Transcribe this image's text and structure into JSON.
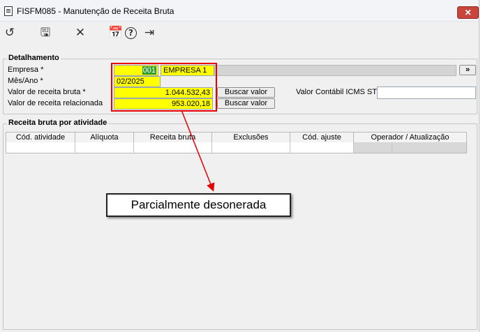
{
  "window": {
    "title": "FISFM085 - Manutenção de Receita Bruta",
    "close_label": "✕"
  },
  "toolbar": {
    "undo_icon": "↺",
    "save_icon": "🖫",
    "cancel_icon": "✕",
    "calendar_icon": "📅",
    "help_icon": "?",
    "exit_icon": "⇥"
  },
  "detalhamento": {
    "legend": "Detalhamento",
    "empresa_label": "Empresa *",
    "empresa_code": "001",
    "empresa_name": "EMPRESA 1",
    "lookup_label": "»",
    "mes_ano_label": "Mês/Ano *",
    "mes_ano_value": "02/2025",
    "receita_bruta_label": "Valor de receita bruta *",
    "receita_bruta_value": "1.044.532,43",
    "receita_relacionada_label": "Valor de receita relacionada",
    "receita_relacionada_value": "953.020,18",
    "buscar_label": "Buscar valor",
    "icms_st_label": "Valor Contábil ICMS ST",
    "icms_st_value": ""
  },
  "atividade": {
    "legend": "Receita bruta por atividade",
    "columns": [
      "Cód. atividade",
      "Alíquota",
      "Receita bruta",
      "Exclusões",
      "Cód. ajuste",
      "Operador / Atualização"
    ]
  },
  "annotation": {
    "callout_text": "Parcialmente desonerada",
    "color": "#e60000"
  }
}
